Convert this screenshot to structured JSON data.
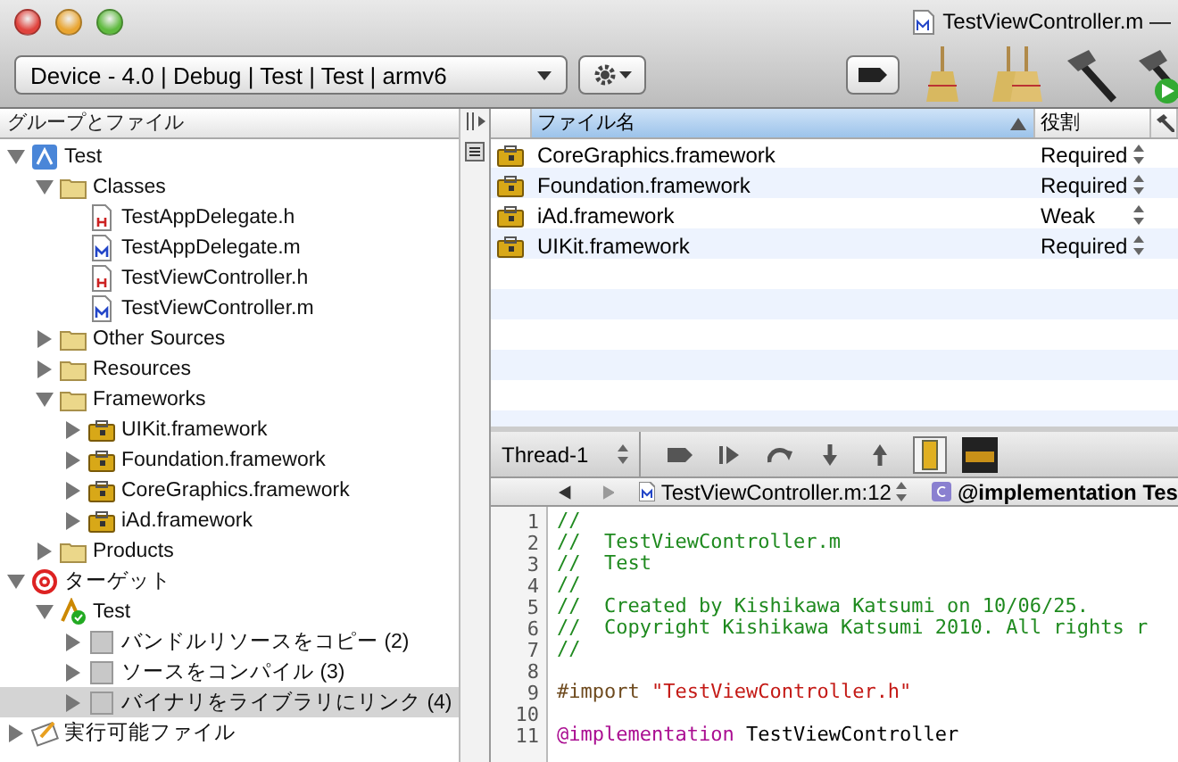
{
  "window": {
    "title": "TestViewController.m —"
  },
  "toolbar": {
    "scheme": "Device - 4.0 | Debug | Test | Test | armv6"
  },
  "sidebar": {
    "header": "グループとファイル",
    "items": [
      {
        "label": "Test",
        "kind": "project",
        "expanded": true,
        "selected": false,
        "children": [
          {
            "label": "Classes",
            "kind": "folder",
            "expanded": true,
            "selected": false,
            "children": [
              {
                "label": "TestAppDelegate.h",
                "kind": "header",
                "selected": false
              },
              {
                "label": "TestAppDelegate.m",
                "kind": "source",
                "selected": false
              },
              {
                "label": "TestViewController.h",
                "kind": "header",
                "selected": false
              },
              {
                "label": "TestViewController.m",
                "kind": "source",
                "selected": false
              }
            ]
          },
          {
            "label": "Other Sources",
            "kind": "folder",
            "expanded": false,
            "selected": false
          },
          {
            "label": "Resources",
            "kind": "folder",
            "expanded": false,
            "selected": false
          },
          {
            "label": "Frameworks",
            "kind": "folder",
            "expanded": true,
            "selected": false,
            "children": [
              {
                "label": "UIKit.framework",
                "kind": "framework",
                "expanded": false,
                "selected": false
              },
              {
                "label": "Foundation.framework",
                "kind": "framework",
                "expanded": false,
                "selected": false
              },
              {
                "label": "CoreGraphics.framework",
                "kind": "framework",
                "expanded": false,
                "selected": false
              },
              {
                "label": "iAd.framework",
                "kind": "framework",
                "expanded": false,
                "selected": false
              }
            ]
          },
          {
            "label": "Products",
            "kind": "folder",
            "expanded": false,
            "selected": false
          }
        ]
      },
      {
        "label": "ターゲット",
        "kind": "target",
        "expanded": true,
        "selected": false,
        "children": [
          {
            "label": "Test",
            "kind": "app",
            "expanded": true,
            "selected": false,
            "children": [
              {
                "label": "バンドルリソースをコピー (2)",
                "kind": "phase",
                "expanded": false,
                "selected": false
              },
              {
                "label": "ソースをコンパイル (3)",
                "kind": "phase",
                "expanded": false,
                "selected": false
              },
              {
                "label": "バイナリをライブラリにリンク (4)",
                "kind": "phase",
                "expanded": false,
                "selected": true
              }
            ]
          }
        ]
      },
      {
        "label": "実行可能ファイル",
        "kind": "executable",
        "expanded": false,
        "selected": false
      }
    ]
  },
  "table": {
    "columns": [
      "ファイル名",
      "役割"
    ],
    "rows": [
      {
        "name": "CoreGraphics.framework",
        "role": "Required"
      },
      {
        "name": "Foundation.framework",
        "role": "Required"
      },
      {
        "name": "iAd.framework",
        "role": "Weak"
      },
      {
        "name": "UIKit.framework",
        "role": "Required"
      }
    ]
  },
  "debugger": {
    "thread": "Thread-1"
  },
  "navigator": {
    "file": "TestViewController.m:12",
    "symbol": "@implementation Tes"
  },
  "code": [
    {
      "number": "1",
      "tokens": [
        {
          "kind": "comment",
          "text": "//"
        }
      ]
    },
    {
      "number": "2",
      "tokens": [
        {
          "kind": "comment",
          "text": "//  TestViewController.m"
        }
      ]
    },
    {
      "number": "3",
      "tokens": [
        {
          "kind": "comment",
          "text": "//  Test"
        }
      ]
    },
    {
      "number": "4",
      "tokens": [
        {
          "kind": "comment",
          "text": "//"
        }
      ]
    },
    {
      "number": "5",
      "tokens": [
        {
          "kind": "comment",
          "text": "//  Created by Kishikawa Katsumi on 10/06/25."
        }
      ]
    },
    {
      "number": "6",
      "tokens": [
        {
          "kind": "comment",
          "text": "//  Copyright Kishikawa Katsumi 2010. All rights r"
        }
      ]
    },
    {
      "number": "7",
      "tokens": [
        {
          "kind": "comment",
          "text": "//"
        }
      ]
    },
    {
      "number": "8"
    },
    {
      "number": "9",
      "tokens": [
        {
          "kind": "directive",
          "text": "#import "
        },
        {
          "kind": "string",
          "text": "\"TestViewController.h\""
        }
      ]
    },
    {
      "number": "10"
    },
    {
      "number": "11",
      "tokens": [
        {
          "kind": "keyword",
          "text": "@implementation"
        },
        {
          "kind": "plain",
          "text": " TestViewController"
        }
      ]
    }
  ]
}
